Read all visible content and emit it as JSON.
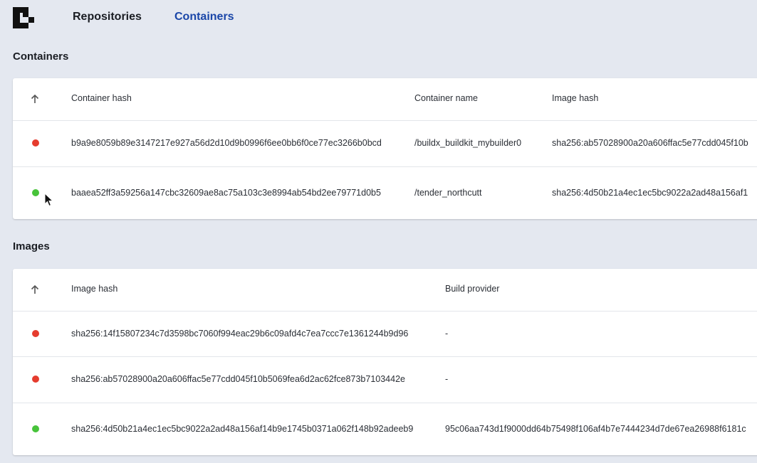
{
  "nav": {
    "logo_icon": "container-logo-icon",
    "links": [
      "Repositories",
      "Containers"
    ],
    "active": "Containers",
    "active_color": "#1a46a8"
  },
  "containers": {
    "title": "Containers",
    "columns": [
      "Container hash",
      "Container name",
      "Image hash"
    ],
    "sort_icon": "arrow-up-icon",
    "rows": [
      {
        "status": "stopped",
        "status_color": "#e53c2e",
        "hash": "b9a9e8059b89e3147217e927a56d2d10d9b0996f6ee0bb6f0ce77ec3266b0bcd",
        "name": "/buildx_buildkit_mybuilder0",
        "image_hash": "sha256:ab57028900a20a606ffac5e77cdd045f10b"
      },
      {
        "status": "running",
        "status_color": "#47c33a",
        "hash": "baaea52ff3a59256a147cbc32609ae8ac75a103c3e8994ab54bd2ee79771d0b5",
        "name": "/tender_northcutt",
        "image_hash": "sha256:4d50b21a4ec1ec5bc9022a2ad48a156af1"
      }
    ]
  },
  "images": {
    "title": "Images",
    "columns": [
      "Image hash",
      "Build provider"
    ],
    "sort_icon": "arrow-up-icon",
    "rows": [
      {
        "status": "unused",
        "status_color": "#e53c2e",
        "hash": "sha256:14f15807234c7d3598bc7060f994eac29b6c09afd4c7ea7ccc7e1361244b9d96",
        "provider": "-"
      },
      {
        "status": "unused",
        "status_color": "#e53c2e",
        "hash": "sha256:ab57028900a20a606ffac5e77cdd045f10b5069fea6d2ac62fce873b7103442e",
        "provider": "-"
      },
      {
        "status": "in-use",
        "status_color": "#47c33a",
        "hash": "sha256:4d50b21a4ec1ec5bc9022a2ad48a156af14b9e1745b0371a062f148b92adeeb9",
        "provider": "95c06aa743d1f9000dd64b75498f106af4b7e7444234d7de67ea26988f6181c"
      }
    ]
  }
}
